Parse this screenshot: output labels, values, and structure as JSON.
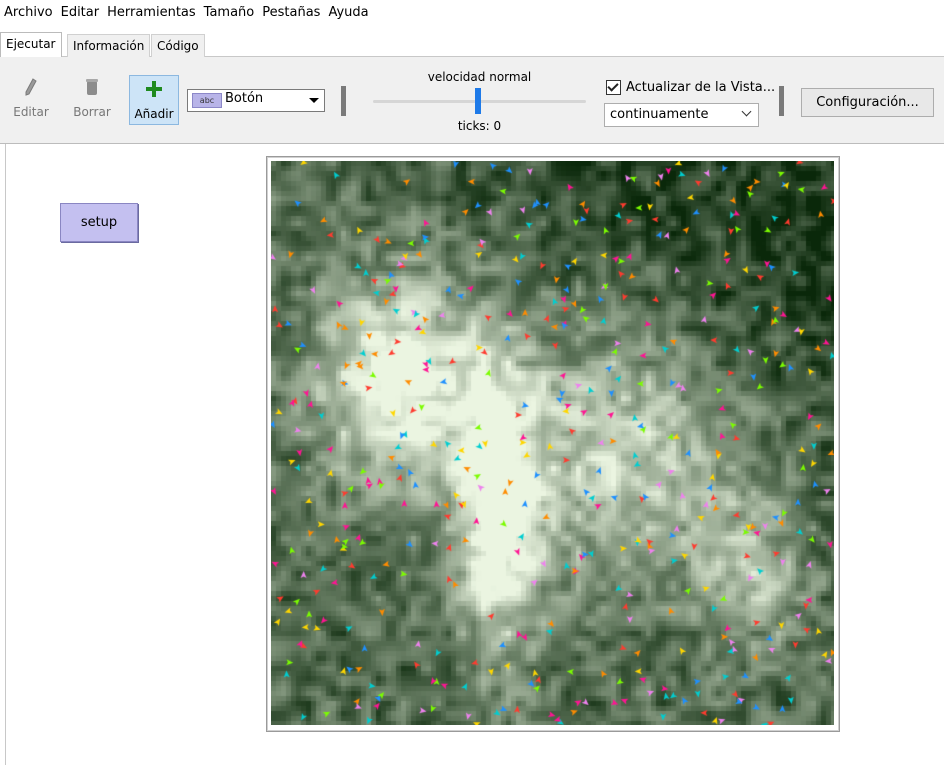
{
  "menubar": [
    "Archivo",
    "Editar",
    "Herramientas",
    "Tamaño",
    "Pestañas",
    "Ayuda"
  ],
  "tabs": [
    "Ejecutar",
    "Información",
    "Código"
  ],
  "toolbar": {
    "edit_label": "Editar",
    "delete_label": "Borrar",
    "add_label": "Añadir",
    "widget_type_tag": "abc",
    "widget_type_value": "Botón",
    "speed_label": "velocidad normal",
    "speed_value": 0.5,
    "ticks_label": "ticks: 0",
    "update_checkbox_label": "Actualizar de la Vista...",
    "update_checked": true,
    "update_mode": "continuamente",
    "settings_button": "Configuración..."
  },
  "interface": {
    "setup_button": "setup"
  },
  "world": {
    "terrain": "green-elevation",
    "agent_colors": [
      "#ff3b2f",
      "#1e90ff",
      "#ffd700",
      "#7cfc00",
      "#ff8c00",
      "#ee82ee",
      "#00ced1",
      "#ff1493"
    ]
  }
}
